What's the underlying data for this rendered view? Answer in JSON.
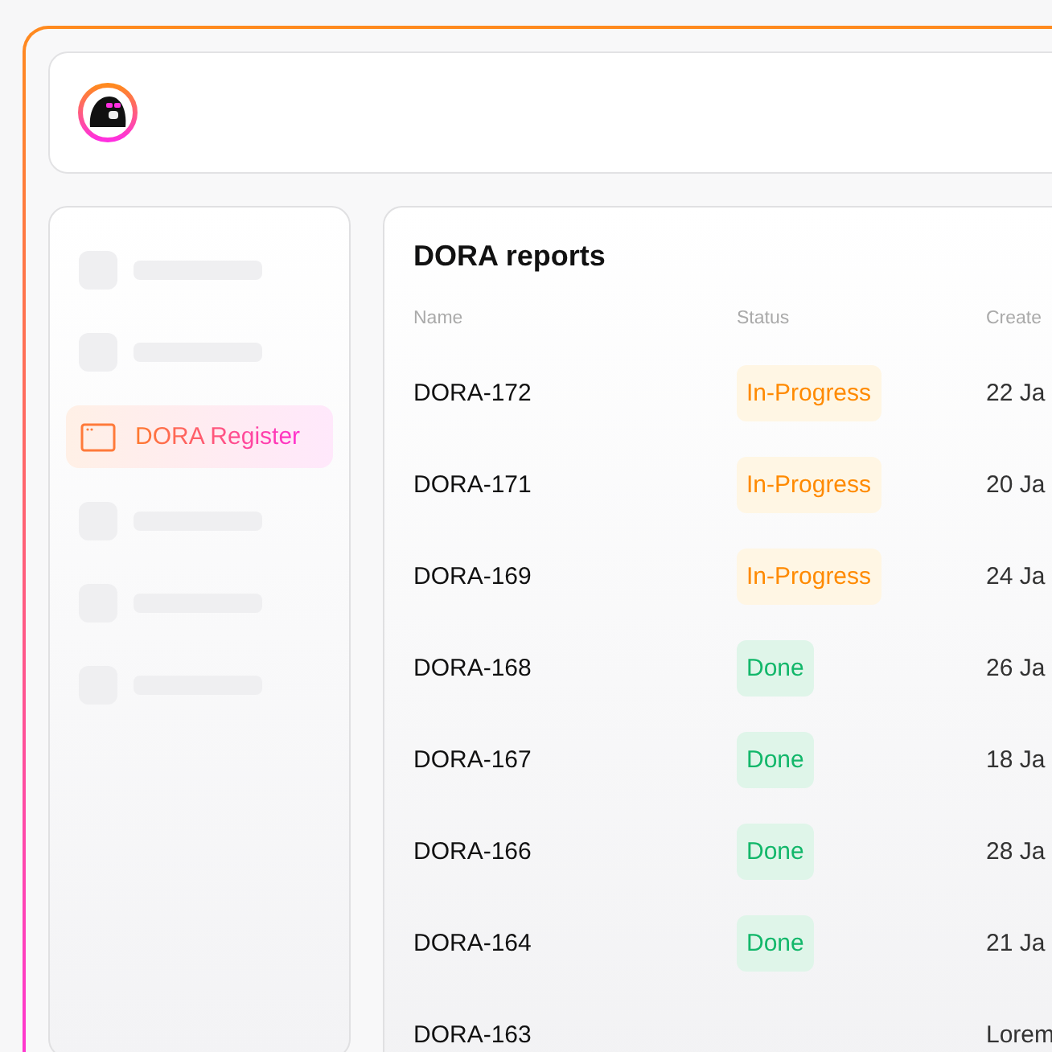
{
  "sidebar": {
    "items": [
      {
        "kind": "skeleton"
      },
      {
        "kind": "skeleton"
      },
      {
        "kind": "link",
        "label": "DORA Register",
        "selected": true
      },
      {
        "kind": "skeleton"
      },
      {
        "kind": "skeleton"
      },
      {
        "kind": "skeleton"
      }
    ]
  },
  "table": {
    "title": "DORA reports",
    "columns": [
      "Name",
      "Status",
      "Create"
    ],
    "rows": [
      {
        "name": "DORA-172",
        "status": {
          "label": "In-Progress",
          "kind": "in-progress"
        },
        "created": "22 Ja"
      },
      {
        "name": "DORA-171",
        "status": {
          "label": "In-Progress",
          "kind": "in-progress"
        },
        "created": "20 Ja"
      },
      {
        "name": "DORA-169",
        "status": {
          "label": "In-Progress",
          "kind": "in-progress"
        },
        "created": "24 Ja"
      },
      {
        "name": "DORA-168",
        "status": {
          "label": "Done",
          "kind": "done"
        },
        "created": "26 Ja"
      },
      {
        "name": "DORA-167",
        "status": {
          "label": "Done",
          "kind": "done"
        },
        "created": "18 Ja"
      },
      {
        "name": "DORA-166",
        "status": {
          "label": "Done",
          "kind": "done"
        },
        "created": "28 Ja"
      },
      {
        "name": "DORA-164",
        "status": {
          "label": "Done",
          "kind": "done"
        },
        "created": "21 Ja"
      },
      {
        "name": "DORA-163",
        "created": "Lorem"
      }
    ]
  }
}
